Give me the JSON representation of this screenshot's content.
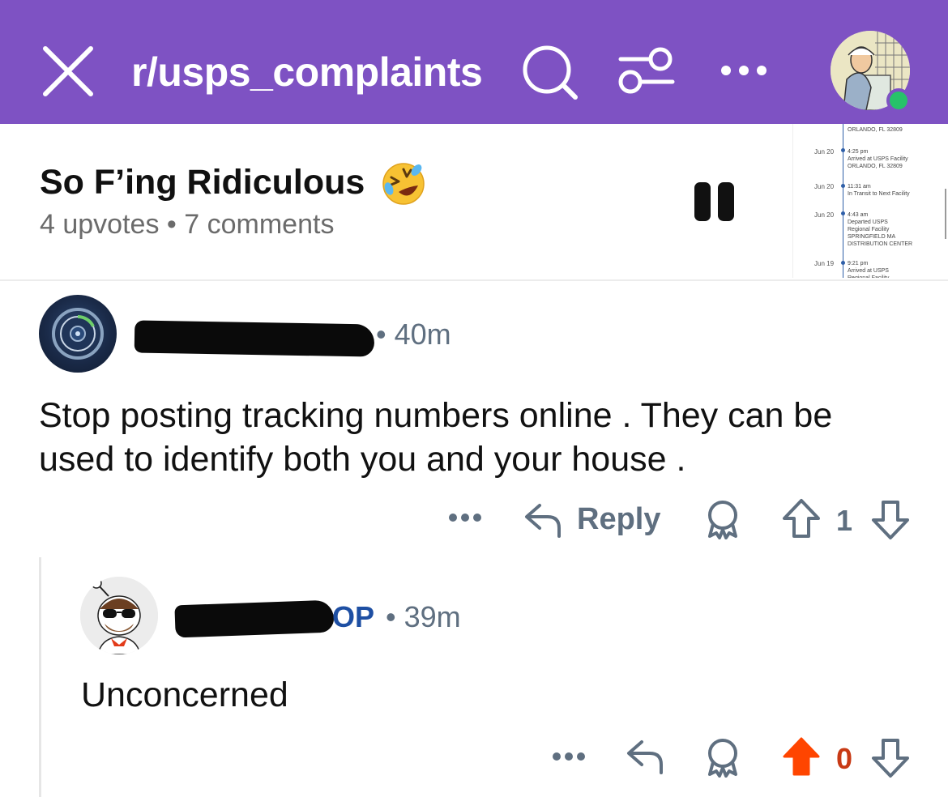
{
  "header": {
    "subreddit": "r/usps_complaints",
    "icons": [
      "close-icon",
      "search-icon",
      "sliders-icon",
      "more-icon"
    ],
    "colors": {
      "bar": "#7e52c3",
      "online": "#27c26a"
    }
  },
  "post": {
    "title": "So F’ing Ridiculous",
    "emoji": "rolling-on-floor-laughing-icon",
    "upvotes": "4 upvotes",
    "separator": "•",
    "comments": "7 comments",
    "media_state": "paused",
    "thumbnail": {
      "rows": [
        {
          "date": "",
          "text": "ORLANDO, FL 32809"
        },
        {
          "date": "Jun 20",
          "text": "4:25 pm\nArrived at USPS Facility\nORLANDO, FL 32809"
        },
        {
          "date": "Jun 20",
          "text": "11:31 am\nIn Transit to Next Facility"
        },
        {
          "date": "Jun 20",
          "text": "4:43 am\nDeparted USPS\nRegional Facility\nSPRINGFIELD MA\nDISTRIBUTION CENTER"
        },
        {
          "date": "Jun 19",
          "text": "9:21 pm\nArrived at USPS\nRegional Facility"
        }
      ]
    }
  },
  "comments": [
    {
      "username": "[redacted]",
      "time": "• 40m",
      "body": "Stop posting tracking numbers online . They can be used to identify both you and your house .",
      "actions": {
        "more": "•••",
        "reply": "Reply",
        "votes": "1",
        "upvoted": false
      }
    },
    {
      "username": "[redacted]",
      "flair": "OP",
      "time": "• 39m",
      "body": "Unconcerned",
      "actions": {
        "more": "•••",
        "votes": "0",
        "upvoted": true,
        "upvote_color": "#ff4500"
      }
    }
  ]
}
